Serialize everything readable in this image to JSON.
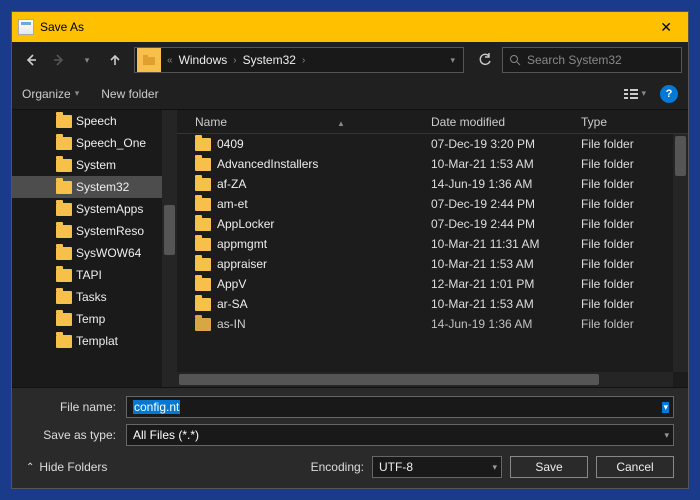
{
  "title": "Save As",
  "breadcrumb": {
    "prefix": "«",
    "part1": "Windows",
    "part2": "System32"
  },
  "search": {
    "placeholder": "Search System32"
  },
  "toolbar": {
    "organize": "Organize",
    "newfolder": "New folder"
  },
  "columns": {
    "name": "Name",
    "date": "Date modified",
    "type": "Type"
  },
  "tree": [
    {
      "label": "Speech"
    },
    {
      "label": "Speech_One"
    },
    {
      "label": "System"
    },
    {
      "label": "System32",
      "selected": true
    },
    {
      "label": "SystemApps"
    },
    {
      "label": "SystemReso"
    },
    {
      "label": "SysWOW64"
    },
    {
      "label": "TAPI"
    },
    {
      "label": "Tasks"
    },
    {
      "label": "Temp"
    },
    {
      "label": "Templat"
    }
  ],
  "rows": [
    {
      "name": "0409",
      "date": "07-Dec-19 3:20 PM",
      "type": "File folder"
    },
    {
      "name": "AdvancedInstallers",
      "date": "10-Mar-21 1:53 AM",
      "type": "File folder"
    },
    {
      "name": "af-ZA",
      "date": "14-Jun-19 1:36 AM",
      "type": "File folder"
    },
    {
      "name": "am-et",
      "date": "07-Dec-19 2:44 PM",
      "type": "File folder"
    },
    {
      "name": "AppLocker",
      "date": "07-Dec-19 2:44 PM",
      "type": "File folder"
    },
    {
      "name": "appmgmt",
      "date": "10-Mar-21 11:31 AM",
      "type": "File folder"
    },
    {
      "name": "appraiser",
      "date": "10-Mar-21 1:53 AM",
      "type": "File folder"
    },
    {
      "name": "AppV",
      "date": "12-Mar-21 1:01 PM",
      "type": "File folder"
    },
    {
      "name": "ar-SA",
      "date": "10-Mar-21 1:53 AM",
      "type": "File folder"
    },
    {
      "name": "as-IN",
      "date": "14-Jun-19 1:36 AM",
      "type": "File folder"
    }
  ],
  "form": {
    "filename_label": "File name:",
    "filename_value": "config.nt",
    "type_label": "Save as type:",
    "type_value": "All Files  (*.*)",
    "encoding_label": "Encoding:",
    "encoding_value": "UTF-8",
    "hide_folders": "Hide Folders",
    "save": "Save",
    "cancel": "Cancel"
  }
}
